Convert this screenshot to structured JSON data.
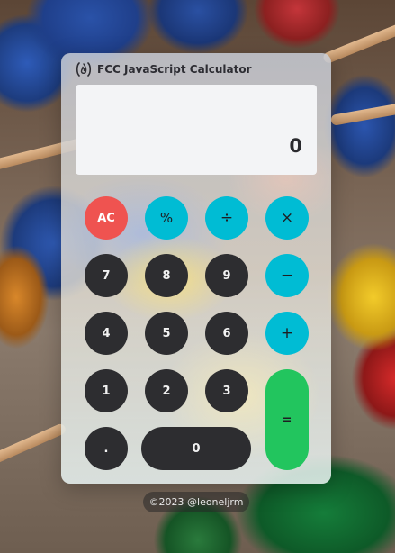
{
  "app": {
    "title": "FCC JavaScript Calculator",
    "logo_icon": "freecodecamp-flame-icon"
  },
  "display": {
    "value": "0"
  },
  "buttons": {
    "clear": "AC",
    "percent": "%",
    "divide": "÷",
    "multiply": "×",
    "seven": "7",
    "eight": "8",
    "nine": "9",
    "minus": "−",
    "four": "4",
    "five": "5",
    "six": "6",
    "plus": "+",
    "one": "1",
    "two": "2",
    "three": "3",
    "equals": "=",
    "decimal": ".",
    "zero": "0"
  },
  "footer": {
    "text": "©2023 @leoneljrm"
  },
  "colors": {
    "operator": "#00bcd4",
    "clear": "#ef5350",
    "equals": "#22c55e",
    "digit": "#2d2d30",
    "display_bg": "#f3f4f6"
  }
}
